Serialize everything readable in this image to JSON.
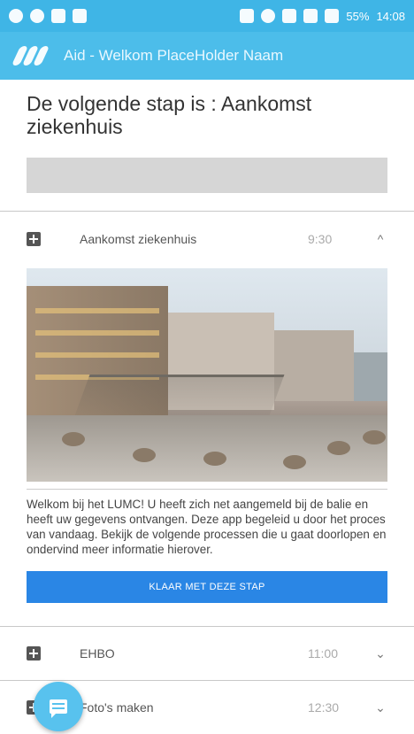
{
  "statusbar": {
    "battery": "55%",
    "time": "14:08"
  },
  "appbar": {
    "title": "Aid - Welkom PlaceHolder Naam"
  },
  "next_step": {
    "heading": "De volgende stap is : Aankomst ziekenhuis"
  },
  "steps": [
    {
      "name": "Aankomst ziekenhuis",
      "time": "9:30",
      "chevron": "^"
    },
    {
      "name": "EHBO",
      "time": "11:00",
      "chevron": "⌄"
    },
    {
      "name": "Foto's maken",
      "time": "12:30",
      "chevron": "⌄"
    }
  ],
  "expanded": {
    "description": "Welkom bij het LUMC! U heeft zich net aangemeld bij de balie en heeft uw gegevens ontvangen. Deze app begeleid u door het proces van vandaag. Bekijk de volgende processen die u gaat doorlopen en ondervind meer informatie hierover.",
    "button_label": "KLAAR MET DEZE STAP"
  },
  "colors": {
    "statusbar": "#3fb5e6",
    "appbar": "#4cbdea",
    "button": "#2a86e5",
    "fab": "#58c2ee"
  }
}
